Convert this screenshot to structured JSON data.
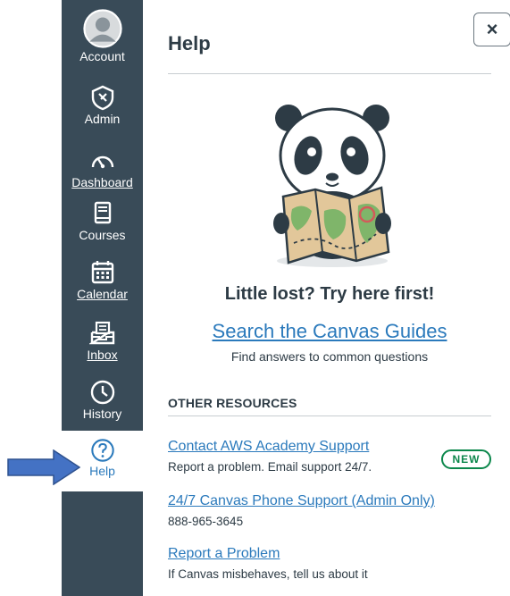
{
  "nav": {
    "account": "Account",
    "admin": "Admin",
    "dashboard": "Dashboard",
    "courses": "Courses",
    "calendar": "Calendar",
    "inbox": "Inbox",
    "history": "History",
    "help": "Help"
  },
  "tray": {
    "title": "Help",
    "close": "×",
    "headline": "Little lost? Try here first!",
    "guides_link": "Search the Canvas Guides",
    "guides_sub": "Find answers to common questions",
    "other_heading": "OTHER RESOURCES",
    "resources": [
      {
        "title": "Contact AWS Academy Support",
        "desc": "Report a problem. Email support 24/7.",
        "badge": "NEW"
      },
      {
        "title": "24/7 Canvas Phone Support (Admin Only)",
        "desc": "888-965-3645"
      },
      {
        "title": "Report a Problem",
        "desc": "If Canvas misbehaves, tell us about it"
      }
    ]
  },
  "colors": {
    "nav_bg": "#394b58",
    "link": "#2b7abc",
    "badge": "#0b874b",
    "arrow": "#4472c4"
  }
}
